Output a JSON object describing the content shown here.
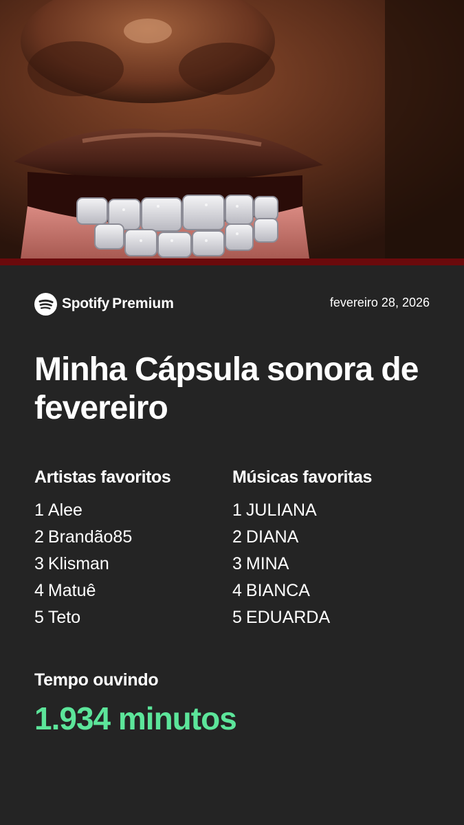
{
  "header": {
    "brand_name": "Spotify",
    "brand_tier": "Premium",
    "date": "fevereiro 28, 2026"
  },
  "title": "Minha Cápsula sonora de fevereiro",
  "artists": {
    "heading": "Artistas favoritos",
    "items": [
      {
        "rank": "1",
        "name": "Alee"
      },
      {
        "rank": "2",
        "name": "Brandão85"
      },
      {
        "rank": "3",
        "name": "Klisman"
      },
      {
        "rank": "4",
        "name": "Matuê"
      },
      {
        "rank": "5",
        "name": "Teto"
      }
    ]
  },
  "songs": {
    "heading": "Músicas favoritas",
    "items": [
      {
        "rank": "1",
        "name": "JULIANA"
      },
      {
        "rank": "2",
        "name": "DIANA"
      },
      {
        "rank": "3",
        "name": "MINA"
      },
      {
        "rank": "4",
        "name": "BIANCA"
      },
      {
        "rank": "5",
        "name": "EDUARDA"
      }
    ]
  },
  "listening_time": {
    "label": "Tempo ouvindo",
    "value": "1.934 minutos"
  },
  "colors": {
    "background": "#242424",
    "accent_green": "#5ce59a",
    "stripe": "#6b0a0c"
  },
  "icons": {
    "brand": "spotify-logo-icon"
  }
}
